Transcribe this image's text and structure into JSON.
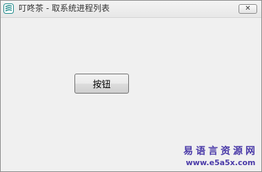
{
  "window": {
    "title": "叮咚茶 - 取系统进程列表",
    "app_icon": "app-logo-icon",
    "close_icon": "close-icon",
    "close_glyph": "✕"
  },
  "main": {
    "button_label": "按钮"
  },
  "watermark": {
    "title": "易语言资源网",
    "url": "www.e5a5x.com"
  },
  "colors": {
    "window_bg": "#f0f0f0",
    "watermark": "#4a3aa8",
    "icon_accent": "#1f8a8a"
  }
}
